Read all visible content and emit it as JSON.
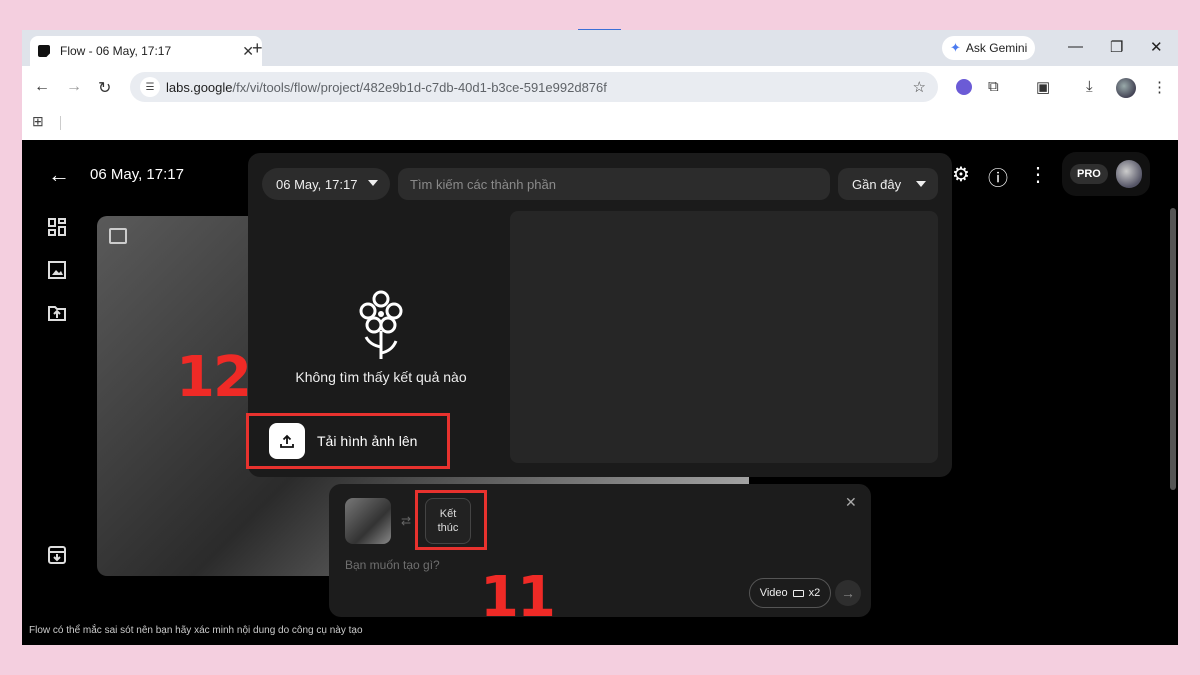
{
  "browser": {
    "tab_title": "Flow - 06 May, 17:17",
    "tab_close": "✕",
    "new_tab": "+",
    "gemini_label": "Ask Gemini",
    "url_domain": "labs.google",
    "url_path": "/fx/vi/tools/flow/project/482e9b1d-c7db-40d1-b3ce-591e992d876f"
  },
  "app": {
    "project_title": "06 May, 17:17",
    "pro_badge": "PRO",
    "disclaimer": "Flow có thể mắc sai sót nên bạn hãy xác minh nội dung do công cụ này tạo"
  },
  "picker": {
    "date_filter": "06 May, 17:17",
    "search_placeholder": "Tìm kiếm các thành phần",
    "sort_label": "Gần đây",
    "empty_text": "Không tìm thấy kết quả nào",
    "upload_label": "Tải hình ảnh lên"
  },
  "prompt": {
    "end_frame_label": "Kết thúc",
    "placeholder": "Bạn muốn tạo gì?",
    "mode_label": "Video",
    "count_label": "x2"
  },
  "annotations": {
    "upload_step": "12",
    "end_frame_step": "11",
    "color": "#e8322e"
  }
}
